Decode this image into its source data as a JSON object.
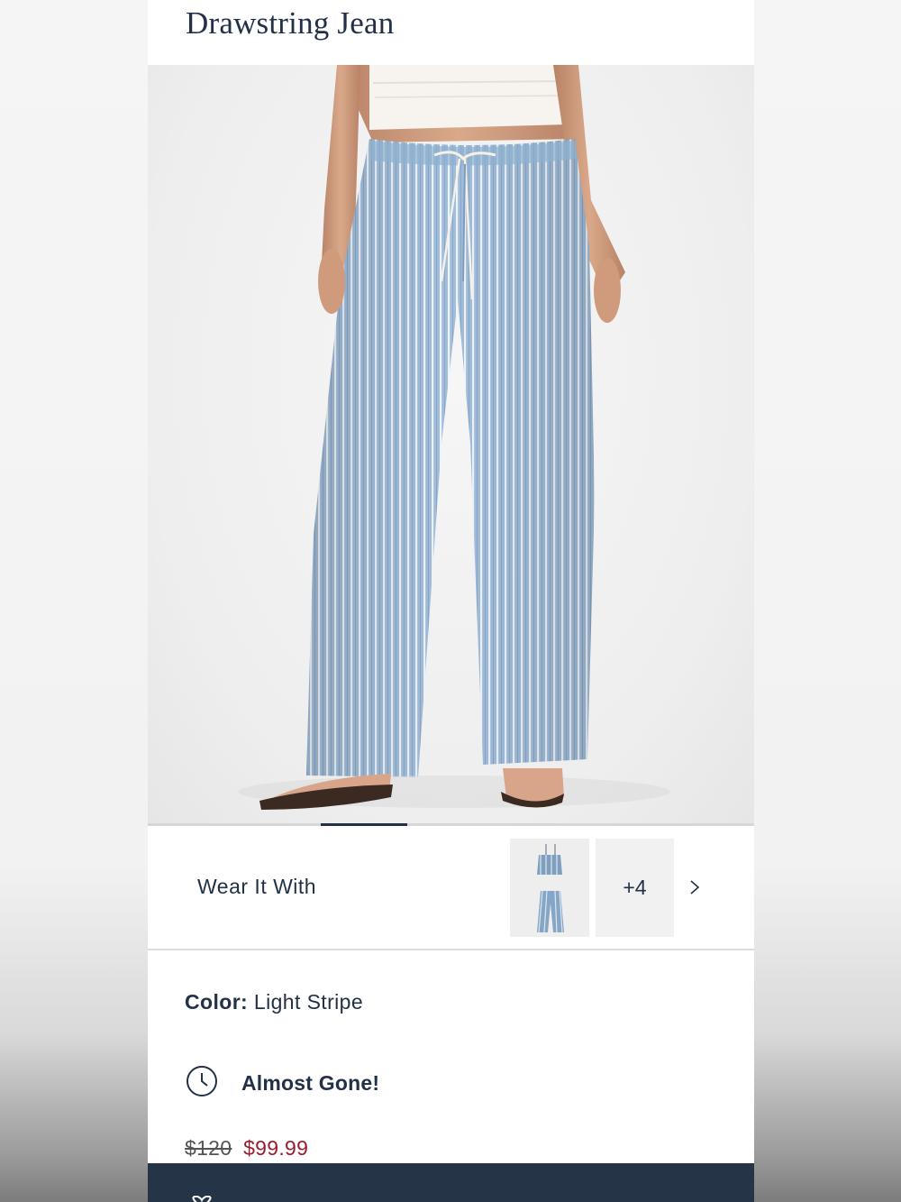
{
  "product": {
    "title": "Drawstring Jean"
  },
  "wear_it_with": {
    "label": "Wear It With",
    "more_count": "+4"
  },
  "details": {
    "color_label": "Color:",
    "color_value": "Light Stripe",
    "stock_status": "Almost Gone!"
  },
  "pricing": {
    "original": "$120",
    "sale": "$99.99"
  },
  "colors": {
    "navy": "#233148",
    "sale_red": "#9b1c2c",
    "bar": "#253446",
    "denim": "#9dbad6"
  },
  "icons": {
    "stock": "clock-icon",
    "next": "chevron-right-icon"
  }
}
